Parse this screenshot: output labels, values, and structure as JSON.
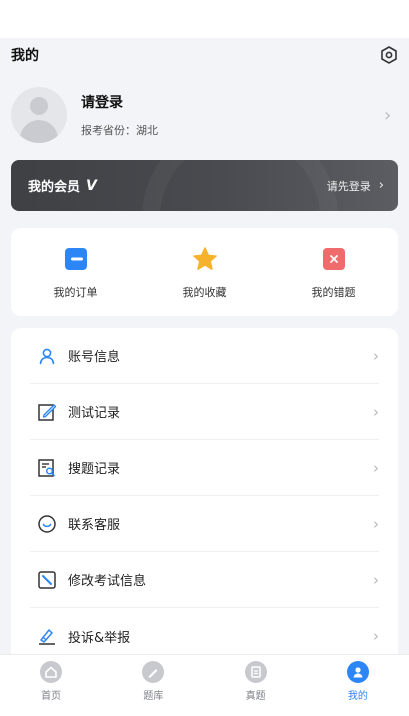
{
  "header": {
    "title": "我的"
  },
  "profile": {
    "login_text": "请登录",
    "province_label": "报考省份：",
    "province_value": "湖北"
  },
  "vip": {
    "title": "我的会员",
    "badge": "V",
    "action": "请先登录",
    "chevron": "›"
  },
  "quick_actions": [
    {
      "label": "我的订单",
      "icon": "order-icon",
      "color": "#2d86f5"
    },
    {
      "label": "我的收藏",
      "icon": "star-icon",
      "color": "#f6b22a"
    },
    {
      "label": "我的错题",
      "icon": "wrong-question-icon",
      "color": "#f06b6b"
    }
  ],
  "menu": [
    {
      "label": "账号信息",
      "icon": "user-icon"
    },
    {
      "label": "测试记录",
      "icon": "edit-record-icon"
    },
    {
      "label": "搜题记录",
      "icon": "search-record-icon"
    },
    {
      "label": "联系客服",
      "icon": "customer-service-icon"
    },
    {
      "label": "修改考试信息",
      "icon": "edit-exam-info-icon"
    },
    {
      "label": "投诉&举报",
      "icon": "complaint-icon"
    }
  ],
  "tabs": [
    {
      "label": "首页",
      "icon": "home-icon",
      "active": false
    },
    {
      "label": "题库",
      "icon": "question-bank-icon",
      "active": false
    },
    {
      "label": "真题",
      "icon": "past-papers-icon",
      "active": false
    },
    {
      "label": "我的",
      "icon": "profile-icon",
      "active": true
    }
  ],
  "colors": {
    "accent": "#2d86f5",
    "vip_bg": "#4a4b50",
    "page_bg": "#f3f4f7"
  }
}
